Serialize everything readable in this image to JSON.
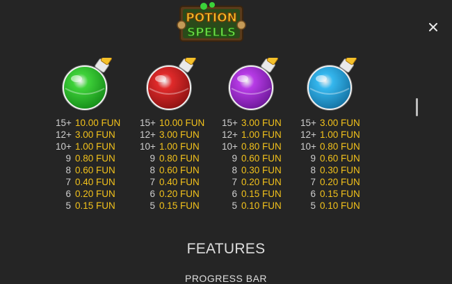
{
  "logo": {
    "line1": "POTION",
    "line2": "SPELLS"
  },
  "header": {
    "close_icon": "close-icon"
  },
  "potions": [
    {
      "color": "green",
      "hex": "#3fd23a",
      "dark": "#138a17",
      "payouts": [
        {
          "count": "15+",
          "value": "10.00 FUN"
        },
        {
          "count": "12+",
          "value": "3.00 FUN"
        },
        {
          "count": "10+",
          "value": "1.00 FUN"
        },
        {
          "count": "9",
          "value": "0.80 FUN"
        },
        {
          "count": "8",
          "value": "0.60 FUN"
        },
        {
          "count": "7",
          "value": "0.40 FUN"
        },
        {
          "count": "6",
          "value": "0.20 FUN"
        },
        {
          "count": "5",
          "value": "0.15 FUN"
        }
      ]
    },
    {
      "color": "red",
      "hex": "#e02a2a",
      "dark": "#8a1212",
      "payouts": [
        {
          "count": "15+",
          "value": "10.00 FUN"
        },
        {
          "count": "12+",
          "value": "3.00 FUN"
        },
        {
          "count": "10+",
          "value": "1.00 FUN"
        },
        {
          "count": "9",
          "value": "0.80 FUN"
        },
        {
          "count": "8",
          "value": "0.60 FUN"
        },
        {
          "count": "7",
          "value": "0.40 FUN"
        },
        {
          "count": "6",
          "value": "0.20 FUN"
        },
        {
          "count": "5",
          "value": "0.15 FUN"
        }
      ]
    },
    {
      "color": "purple",
      "hex": "#b73be6",
      "dark": "#6a1796",
      "payouts": [
        {
          "count": "15+",
          "value": "3.00 FUN"
        },
        {
          "count": "12+",
          "value": "1.00 FUN"
        },
        {
          "count": "10+",
          "value": "0.80 FUN"
        },
        {
          "count": "9",
          "value": "0.60 FUN"
        },
        {
          "count": "8",
          "value": "0.30 FUN"
        },
        {
          "count": "7",
          "value": "0.20 FUN"
        },
        {
          "count": "6",
          "value": "0.15 FUN"
        },
        {
          "count": "5",
          "value": "0.10 FUN"
        }
      ]
    },
    {
      "color": "blue",
      "hex": "#35b7ee",
      "dark": "#136fa0",
      "payouts": [
        {
          "count": "15+",
          "value": "3.00 FUN"
        },
        {
          "count": "12+",
          "value": "1.00 FUN"
        },
        {
          "count": "10+",
          "value": "0.80 FUN"
        },
        {
          "count": "9",
          "value": "0.60 FUN"
        },
        {
          "count": "8",
          "value": "0.30 FUN"
        },
        {
          "count": "7",
          "value": "0.20 FUN"
        },
        {
          "count": "6",
          "value": "0.15 FUN"
        },
        {
          "count": "5",
          "value": "0.10 FUN"
        }
      ]
    }
  ],
  "sections": {
    "features_title": "FEATURES",
    "progress_bar_title": "PROGRESS BAR"
  }
}
